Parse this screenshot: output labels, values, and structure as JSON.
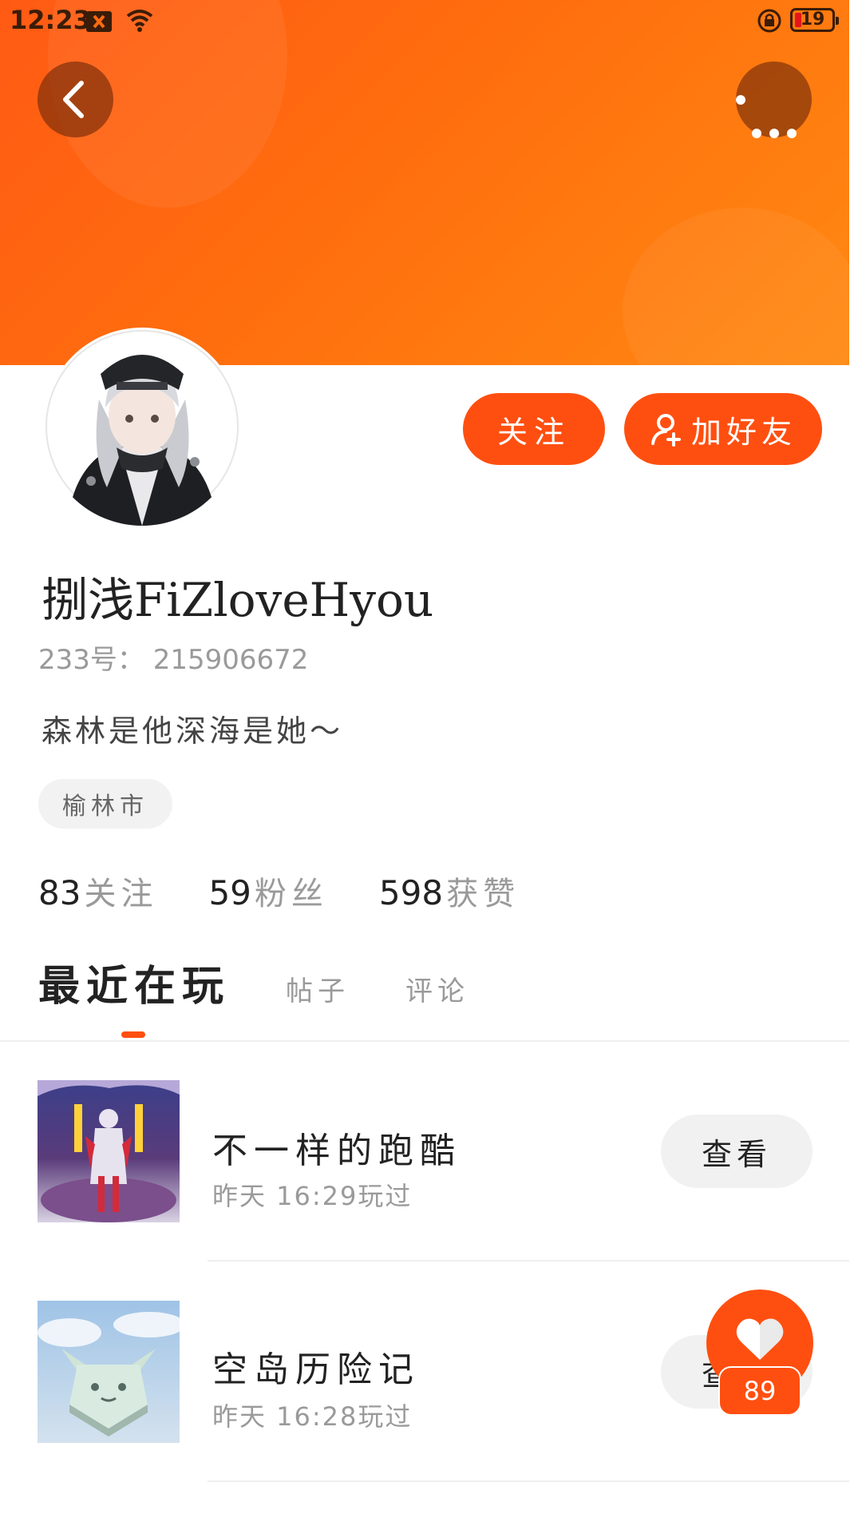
{
  "status_bar": {
    "time": "12:23",
    "battery": "19"
  },
  "header": {
    "back_icon": "chevron-left-icon",
    "more_icon": "more-horizontal-icon",
    "banner_color": "#ff6a10"
  },
  "profile": {
    "follow_label": "关注",
    "add_friend_label": "加好友",
    "username": "捌浅FiZloveHyou",
    "uid": "233号： 215906672",
    "bio": "森林是他深海是她～",
    "location_tag": "榆林市"
  },
  "stats": [
    {
      "value": "83",
      "label": "关注"
    },
    {
      "value": "59",
      "label": "粉丝"
    },
    {
      "value": "598",
      "label": "获赞"
    }
  ],
  "tabs": [
    {
      "label": "最近在玩",
      "active": true
    },
    {
      "label": "帖子",
      "active": false
    },
    {
      "label": "评论",
      "active": false
    }
  ],
  "games": [
    {
      "title": "不一样的跑酷",
      "time": "昨天 16:29玩过",
      "action": "查看"
    },
    {
      "title": "空岛历险记",
      "time": "昨天 16:28玩过",
      "action": "查看"
    }
  ],
  "like_fab": {
    "icon": "heart-icon",
    "count": "89"
  },
  "accent_color": "#ff4f10"
}
